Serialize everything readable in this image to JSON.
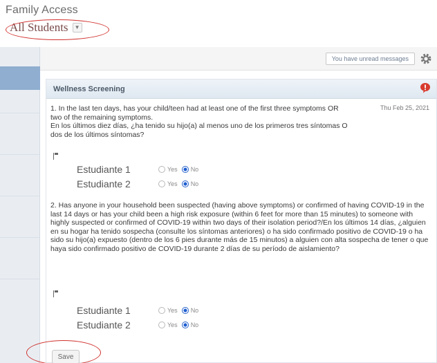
{
  "app": {
    "title": "Family Access"
  },
  "student_selector": {
    "selected": "All Students"
  },
  "toolbar": {
    "messages_label": "You have unread messages"
  },
  "panel": {
    "title": "Wellness Screening",
    "date": "Thu Feb 25, 2021",
    "questions": [
      {
        "text": "1. In the last ten days, has your child/teen had at least one of the first three symptoms OR two of the remaining symptoms.\nEn los últimos diez días, ¿ha tenido su hijo(a) al menos uno de los primeros tres síntomas O dos de los últimos síntomas?",
        "rows": [
          {
            "student": "Estudiante 1",
            "yes_label": "Yes",
            "no_label": "No",
            "selected": "No"
          },
          {
            "student": "Estudiante 2",
            "yes_label": "Yes",
            "no_label": "No",
            "selected": "No"
          }
        ]
      },
      {
        "text": "2. Has anyone in your household been suspected (having above symptoms) or confirmed of having COVID-19 in the last 14 days or has your child been a high risk exposure (within 6 feet for more than 15 minutes) to someone with highly suspected or confirmed of COVID-19 within two days of their isolation period?/En los últimos 14 días, ¿alguien en su hogar ha tenido sospecha (consulte los síntomas anteriores) o ha sido confirmado positivo de COVID-19 o ha sido su hijo(a) expuesto (dentro de los 6 pies durante más de 15 minutos) a alguien con alta sospecha de tener o que haya sido confirmado positivo de COVID-19 durante 2 días de su período de aislamiento?",
        "rows": [
          {
            "student": "Estudiante 1",
            "yes_label": "Yes",
            "no_label": "No",
            "selected": "No"
          },
          {
            "student": "Estudiante 2",
            "yes_label": "Yes",
            "no_label": "No",
            "selected": "No"
          }
        ]
      }
    ],
    "save_label": "Save"
  },
  "colors": {
    "highlight": "#d0312d",
    "radio_selected": "#1f5fd1",
    "alert": "#d83b2f",
    "header_title": "#4b5968"
  },
  "icons": {
    "settings": "gear-icon",
    "alert": "alert-bubble-icon",
    "dropdown": "chevron-down-icon",
    "flag": "flag-icon"
  }
}
